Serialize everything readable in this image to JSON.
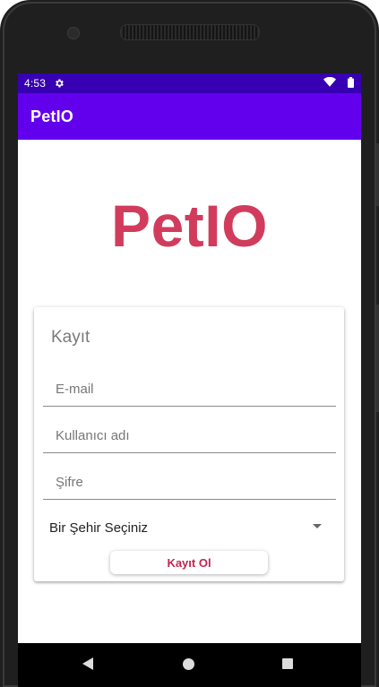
{
  "status_bar": {
    "time": "4:53",
    "icons": [
      "settings-gear-icon",
      "wifi-icon",
      "battery-icon"
    ]
  },
  "app_bar": {
    "title": "PetIO"
  },
  "logo": {
    "text": "PetIO",
    "color": "#d13c5d"
  },
  "form": {
    "title": "Kayıt",
    "email": {
      "placeholder": "E-mail",
      "value": ""
    },
    "username": {
      "placeholder": "Kullanıcı adı",
      "value": ""
    },
    "password": {
      "placeholder": "Şifre",
      "value": ""
    },
    "city_select": {
      "selected": "Bir Şehir Seçiniz"
    },
    "submit_label": "Kayıt Ol"
  },
  "colors": {
    "status_bar": "#3700b3",
    "app_bar": "#6200ee",
    "accent": "#d13c5d"
  },
  "nav_bar": {
    "icons": [
      "back-icon",
      "home-icon",
      "recents-icon"
    ]
  }
}
